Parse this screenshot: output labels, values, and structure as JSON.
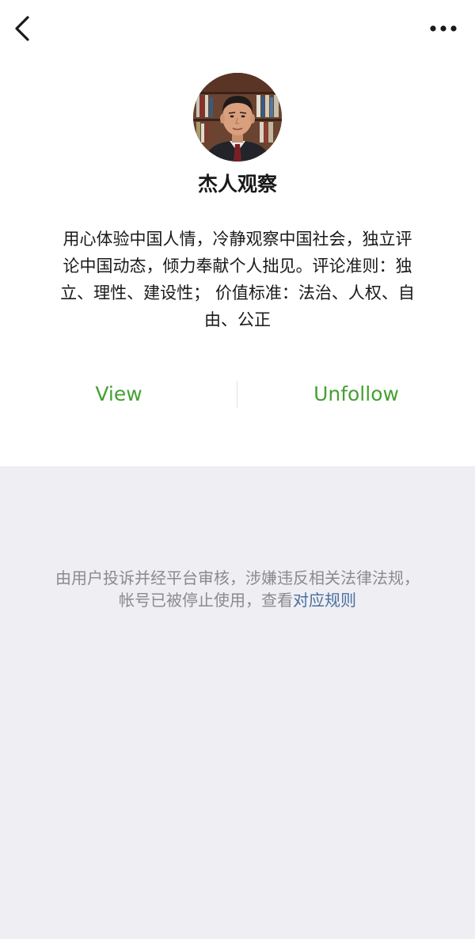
{
  "nav": {
    "back_icon": "chevron-left-icon",
    "more_icon": "more-horizontal-icon"
  },
  "profile": {
    "name": "杰人观察",
    "description": "用心体验中国人情，冷静观察中国社会，独立评论中国动态，倾力奉献个人拙见。评论准则：独立、理性、建设性； 价值标准：法治、人权、自由、公正"
  },
  "actions": {
    "view_label": "View",
    "unfollow_label": "Unfollow"
  },
  "notice": {
    "text": "由用户投诉并经平台审核，涉嫌违反相关法律法规，帐号已被停止使用，查看",
    "link_label": "对应规则"
  },
  "colors": {
    "accent_green": "#45a033",
    "link_blue": "#4a6f9f",
    "gray_background": "#eeeef3"
  }
}
